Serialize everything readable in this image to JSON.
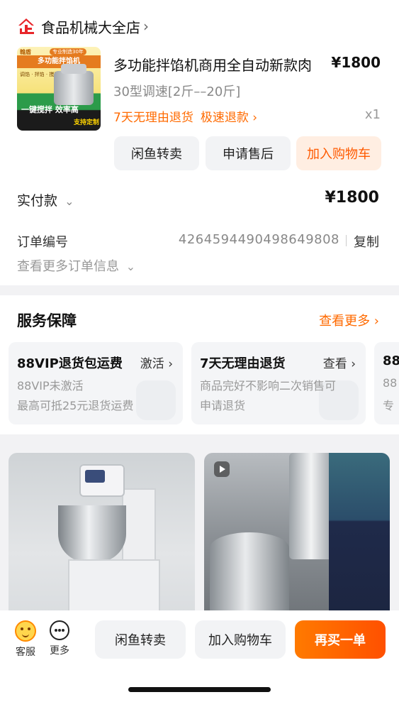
{
  "shop": {
    "name": "食品机械大全店",
    "logo_text": "企"
  },
  "product": {
    "image": {
      "brand": "翰盾",
      "tag": "专业制造30年",
      "headline": "多功能拌馅机",
      "features": "调馅 · 拌馅 · 搅馅",
      "bottom": "一键搅拌 效率高 ",
      "custom": "支持定制"
    },
    "title": "多功能拌馅机商用全自动新款肉",
    "price": "¥1800",
    "spec": "30型调速[2斤––20斤]",
    "return_policy": "7天无理由退货",
    "fast_refund": "极速退款 ›",
    "quantity": "x1",
    "buttons": [
      "闲鱼转卖",
      "申请售后",
      "加入购物车"
    ]
  },
  "payment": {
    "label": "实付款",
    "value": "¥1800"
  },
  "order": {
    "label": "订单编号",
    "number": "4264594490498649808",
    "copy": "复制",
    "more": "查看更多订单信息"
  },
  "service": {
    "title": "服务保障",
    "more": "查看更多 ›",
    "cards": [
      {
        "title": "88VIP退货包运费",
        "action": "激活 ›",
        "lines": [
          "88VIP未激活",
          "最高可抵25元退货运费"
        ]
      },
      {
        "title": "7天无理由退货",
        "action": "查看 ›",
        "lines": [
          "商品完好不影响二次销售可",
          "申请退货"
        ]
      },
      {
        "title": "88",
        "action": "",
        "lines": [
          "88",
          "专"
        ]
      }
    ]
  },
  "bottom_bar": {
    "tabs": [
      {
        "label": "客服",
        "icon": "customer-service-icon"
      },
      {
        "label": "更多",
        "icon": "more-icon"
      }
    ],
    "buttons": [
      "闲鱼转卖",
      "加入购物车",
      "再买一单"
    ]
  },
  "colors": {
    "accent": "#ff6a00",
    "primary_button": "#ff5a00"
  }
}
